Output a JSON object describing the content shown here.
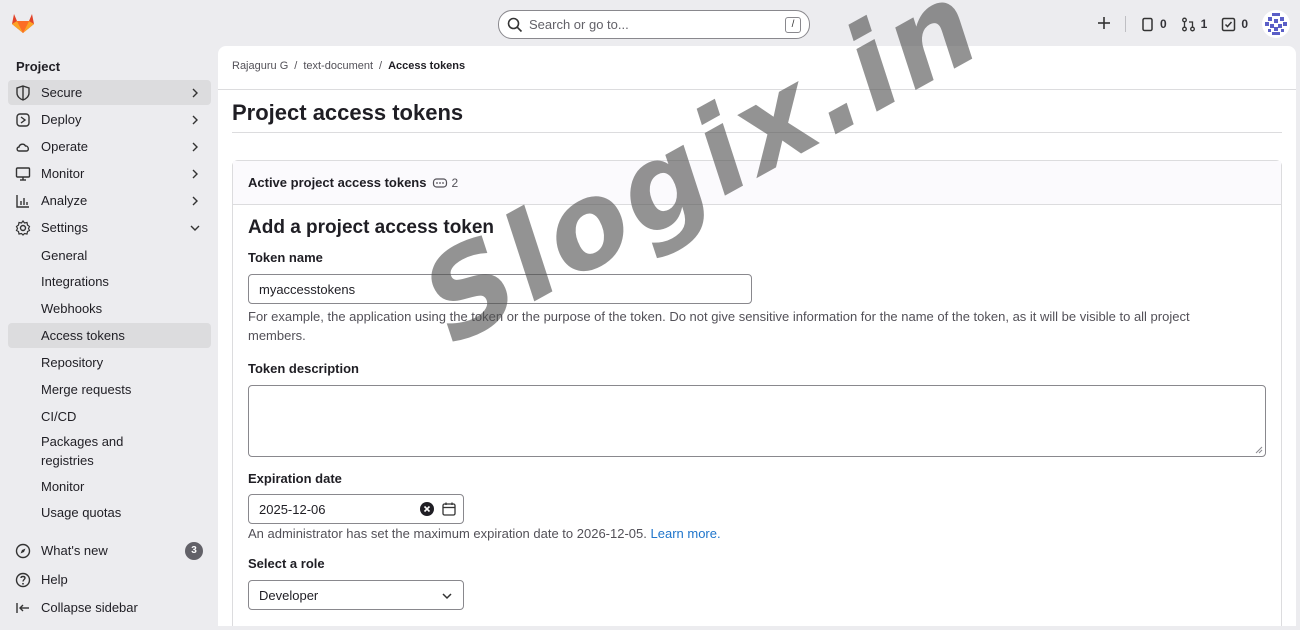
{
  "topbar": {
    "search_placeholder": "Search or go to...",
    "search_shortcut": "/",
    "issues_count": "0",
    "merge_requests_count": "1",
    "todos_count": "0"
  },
  "sidebar": {
    "title": "Project",
    "items": [
      {
        "label": "Secure",
        "icon": "shield-icon"
      },
      {
        "label": "Deploy",
        "icon": "deploy-icon"
      },
      {
        "label": "Operate",
        "icon": "cloud-icon"
      },
      {
        "label": "Monitor",
        "icon": "monitor-icon"
      },
      {
        "label": "Analyze",
        "icon": "chart-icon"
      },
      {
        "label": "Settings",
        "icon": "gear-icon"
      }
    ],
    "settings_sub": [
      {
        "label": "General"
      },
      {
        "label": "Integrations"
      },
      {
        "label": "Webhooks"
      },
      {
        "label": "Access tokens"
      },
      {
        "label": "Repository"
      },
      {
        "label": "Merge requests"
      },
      {
        "label": "CI/CD"
      },
      {
        "label": "Packages and registries"
      },
      {
        "label": "Monitor"
      },
      {
        "label": "Usage quotas"
      }
    ],
    "whats_new": "What's new",
    "whats_new_count": "3",
    "help": "Help",
    "collapse": "Collapse sidebar"
  },
  "breadcrumb": {
    "items": [
      "Rajaguru G",
      "text-document",
      "Access tokens"
    ],
    "separator": "/"
  },
  "page": {
    "title": "Project access tokens"
  },
  "card": {
    "header_title": "Active project access tokens",
    "header_count": "2",
    "form_title": "Add a project access token",
    "token_name_label": "Token name",
    "token_name_value": "myaccesstokens",
    "token_name_help": "For example, the application using the token or the purpose of the token. Do not give sensitive information for the name of the token, as it will be visible to all project members.",
    "token_description_label": "Token description",
    "expiration_label": "Expiration date",
    "expiration_value": "2025-12-06",
    "expiration_help": "An administrator has set the maximum expiration date to 2026-12-05.",
    "expiration_link": "Learn more.",
    "role_label": "Select a role",
    "role_value": "Developer"
  },
  "watermark": "Slogix.in"
}
